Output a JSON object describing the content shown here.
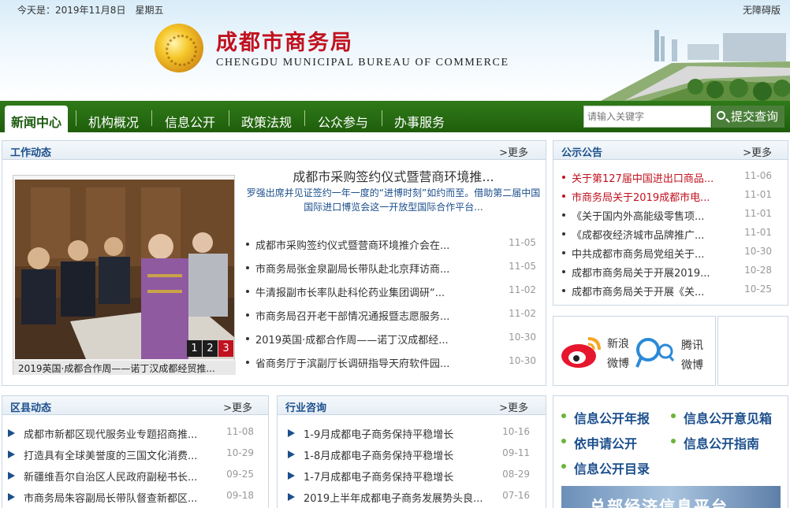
{
  "header": {
    "date": "今天是：2019年11月8日　星期五",
    "accessibility": "无障碍版",
    "title": "成都市商务局",
    "subtitle": "CHENGDU MUNICIPAL BUREAU OF COMMERCE"
  },
  "nav": {
    "items": [
      "新闻中心",
      "机构概况",
      "信息公开",
      "政策法规",
      "公众参与",
      "办事服务"
    ]
  },
  "search": {
    "placeholder": "请输入关键字",
    "button": "提交查询"
  },
  "work": {
    "title": "工作动态",
    "more": ">更多",
    "headline": "成都市采购签约仪式暨营商环境推...",
    "summary": "罗强出席并见证签约一年一度的“进博时刻”如约而至。借助第二届中国国际进口博览会这一开放型国际合作平台...",
    "caption": "2019英国·成都合作周——诺丁汉成都经贸推...",
    "pager": [
      "1",
      "2",
      "3"
    ],
    "items": [
      {
        "text": "成都市采购签约仪式暨营商环境推介会在...",
        "date": "11-05"
      },
      {
        "text": "市商务局张金泉副局长带队赴北京拜访商...",
        "date": "11-05"
      },
      {
        "text": "牛清报副市长率队赴科伦药业集团调研“...",
        "date": "11-02"
      },
      {
        "text": "市商务局召开老干部情况通报暨志愿服务...",
        "date": "11-02"
      },
      {
        "text": "2019英国·成都合作周——诺丁汉成都经...",
        "date": "10-30"
      },
      {
        "text": "省商务厅于滨副厅长调研指导天府软件园...",
        "date": "10-30"
      }
    ]
  },
  "notice": {
    "title": "公示公告",
    "more": ">更多",
    "items": [
      {
        "text": "关于第127届中国进出口商品...",
        "date": "11-06",
        "red": true
      },
      {
        "text": "市商务局关于2019成都市电...",
        "date": "11-01",
        "red": true
      },
      {
        "text": "《关于国内外高能级零售项...",
        "date": "11-01",
        "red": false
      },
      {
        "text": "《成都夜经济城市品牌推广...",
        "date": "11-01",
        "red": false
      },
      {
        "text": "中共成都市商务局党组关于...",
        "date": "10-30",
        "red": false
      },
      {
        "text": "成都市商务局关于开展2019...",
        "date": "10-28",
        "red": false
      },
      {
        "text": "成都市商务局关于开展《关...",
        "date": "10-25",
        "red": false
      }
    ]
  },
  "social": {
    "weibo1": "新浪",
    "weibo2": "微博",
    "tx1": "腾讯",
    "tx2": "微博"
  },
  "district": {
    "title": "区县动态",
    "more": ">更多",
    "items": [
      {
        "text": "成都市新都区现代服务业专题招商推...",
        "date": "11-08"
      },
      {
        "text": "打造具有全球美誉度的三国文化消费...",
        "date": "10-29"
      },
      {
        "text": "新疆维吾尔自治区人民政府副秘书长...",
        "date": "09-25"
      },
      {
        "text": "市商务局朱容副局长带队督查新都区...",
        "date": "09-18"
      }
    ]
  },
  "industry": {
    "title": "行业咨询",
    "more": ">更多",
    "items": [
      {
        "text": "1-9月成都电子商务保持平稳增长",
        "date": "10-16"
      },
      {
        "text": "1-8月成都电子商务保持平稳增长",
        "date": "09-11"
      },
      {
        "text": "1-7月成都电子商务保持平稳增长",
        "date": "08-29"
      },
      {
        "text": "2019上半年成都电子商务发展势头良...",
        "date": "07-16"
      }
    ]
  },
  "info_public": {
    "links": [
      "信息公开年报",
      "信息公开意见箱",
      "依申请公开",
      "信息公开指南",
      "信息公开目录"
    ],
    "banner": "总部经济信息平台"
  },
  "colors": {
    "nav_green": "#2f7a18",
    "title_red": "#c1121f",
    "link_blue": "#1c4f8c"
  }
}
